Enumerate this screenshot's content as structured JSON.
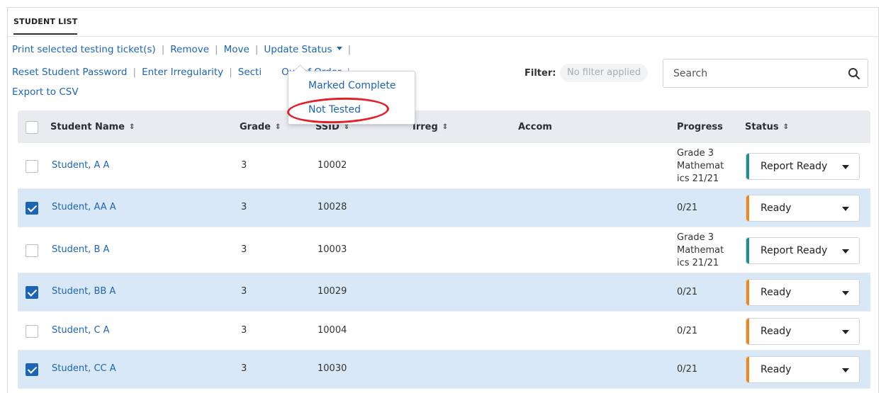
{
  "panel": {
    "title": "STUDENT LIST"
  },
  "actions": {
    "print_tickets": "Print selected testing ticket(s)",
    "remove": "Remove",
    "move": "Move",
    "update_status": "Update Status",
    "reset_password": "Reset Student Password",
    "enter_irregularity": "Enter Irregularity",
    "section_prefix": "Secti",
    "section_suffix": "Out of Order",
    "export_csv": "Export to CSV",
    "separator": "|"
  },
  "filter": {
    "label": "Filter:",
    "value": "No filter applied"
  },
  "search": {
    "placeholder": "Search"
  },
  "dropdown_menu": {
    "items": [
      "Marked Complete",
      "Not Tested"
    ]
  },
  "table": {
    "columns": {
      "name": "Student Name",
      "grade": "Grade",
      "ssid": "SSID",
      "irreg": "Irreg",
      "accom": "Accom",
      "progress": "Progress",
      "status": "Status"
    },
    "sort_glyph": "⇕",
    "rows": [
      {
        "name": "Student, A A",
        "grade": "3",
        "ssid": "10002",
        "progress": [
          "Grade 3",
          "Mathemat",
          "ics 21/21"
        ],
        "status": "Report Ready",
        "checked": false
      },
      {
        "name": "Student, AA A",
        "grade": "3",
        "ssid": "10028",
        "progress": [
          "0/21"
        ],
        "status": "Ready",
        "checked": true
      },
      {
        "name": "Student, B A",
        "grade": "3",
        "ssid": "10003",
        "progress": [
          "Grade 3",
          "Mathemat",
          "ics 21/21"
        ],
        "status": "Report Ready",
        "checked": false
      },
      {
        "name": "Student, BB A",
        "grade": "3",
        "ssid": "10029",
        "progress": [
          "0/21"
        ],
        "status": "Ready",
        "checked": true
      },
      {
        "name": "Student, C A",
        "grade": "3",
        "ssid": "10004",
        "progress": [
          "0/21"
        ],
        "status": "Ready",
        "checked": false
      },
      {
        "name": "Student, CC A",
        "grade": "3",
        "ssid": "10030",
        "progress": [
          "0/21"
        ],
        "status": "Ready",
        "checked": true
      }
    ]
  },
  "colors": {
    "link": "#1c65b3",
    "selected_row": "#d9e8f6",
    "report_ready": "#1f9090",
    "ready": "#f0871e",
    "highlight_ring": "#e0202a"
  }
}
